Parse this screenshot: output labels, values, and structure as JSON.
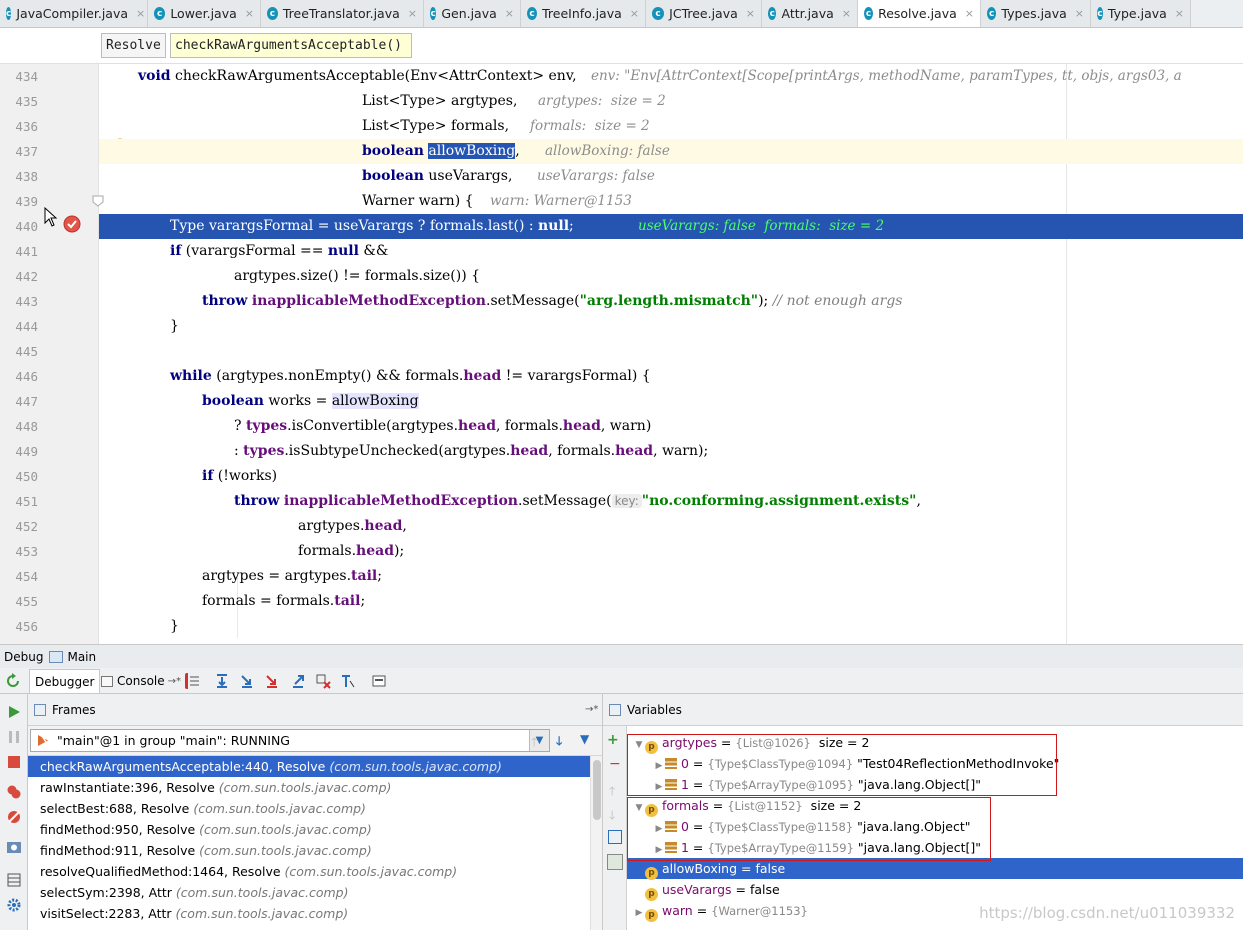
{
  "tabs": [
    {
      "label": "JavaCompiler.java",
      "active": false
    },
    {
      "label": "Lower.java",
      "active": false
    },
    {
      "label": "TreeTranslator.java",
      "active": false
    },
    {
      "label": "Gen.java",
      "active": false
    },
    {
      "label": "TreeInfo.java",
      "active": false
    },
    {
      "label": "JCTree.java",
      "active": false
    },
    {
      "label": "Attr.java",
      "active": false
    },
    {
      "label": "Resolve.java",
      "active": true
    },
    {
      "label": "Types.java",
      "active": false
    },
    {
      "label": "Type.java",
      "active": false
    }
  ],
  "breadcrumbs": [
    "Resolve",
    "checkRawArgumentsAcceptable()"
  ],
  "code": {
    "line_numbers": [
      "434",
      "435",
      "436",
      "437",
      "438",
      "439",
      "440",
      "441",
      "442",
      "443",
      "444",
      "445",
      "446",
      "447",
      "448",
      "449",
      "450",
      "451",
      "452",
      "453",
      "454",
      "455",
      "456"
    ],
    "l434": "void checkRawArgumentsAcceptable(Env<AttrContext> env,",
    "l434_kw": "void",
    "l434_rest": " checkRawArgumentsAcceptable(Env<AttrContext> env,",
    "l434_hint": "env: \"Env[AttrContext[Scope[printArgs, methodName, paramTypes, tt, objs, args03, a",
    "l435": "List<Type> argtypes,",
    "l435_hint": "argtypes:  size = 2",
    "l436": "List<Type> formals,",
    "l436_hint": "formals:  size = 2",
    "l437_kw": "boolean",
    "l437_sel": "allowBoxing",
    "l437_rest": ",",
    "l437_hint": "allowBoxing: false",
    "l438_kw": "boolean",
    "l438_rest": " useVarargs,",
    "l438_hint": "useVarargs: false",
    "l439": "Warner warn) {",
    "l439_hint": "warn: Warner@1153",
    "l440_a": "Type varargsFormal = useVarargs ? formals.last() : ",
    "l440_kw": "null",
    "l440_b": ";",
    "l440_hint": "useVarargs: false  formals:  size = 2",
    "l441_kw": "if",
    "l441_a": " (varargsFormal == ",
    "l441_kw2": "null",
    "l441_b": " &&",
    "l442": "argtypes.size() != formals.size()) {",
    "l443_kw": "throw",
    "l443_fn": "inapplicableMethodException",
    "l443_a": ".setMessage(",
    "l443_str": "\"arg.length.mismatch\"",
    "l443_b": "); ",
    "l443_cm": "// not enough args",
    "l444": "}",
    "l446_kw": "while",
    "l446_a": " (argtypes.nonEmpty() && formals.",
    "l446_f": "head",
    "l446_b": " != varargsFormal) {",
    "l447_kw": "boolean",
    "l447_a": " works = ",
    "l447_m": "allowBoxing",
    "l448_a": "? ",
    "l448_t": "types",
    "l448_b": ".isConvertible(argtypes.",
    "l448_h1": "head",
    "l448_c": ", formals.",
    "l448_h2": "head",
    "l448_d": ", warn)",
    "l449_a": ": ",
    "l449_t": "types",
    "l449_b": ".isSubtypeUnchecked(argtypes.",
    "l449_h1": "head",
    "l449_c": ", formals.",
    "l449_h2": "head",
    "l449_d": ", warn);",
    "l450_kw": "if",
    "l450_a": " (!works)",
    "l451_kw": "throw",
    "l451_fn": "inapplicableMethodException",
    "l451_a": ".setMessage(",
    "l451_param": "key:",
    "l451_str": "\"no.conforming.assignment.exists\"",
    "l451_b": ",",
    "l452_a": "argtypes.",
    "l452_h": "head",
    "l452_b": ",",
    "l453_a": "formals.",
    "l453_h": "head",
    "l453_b": ");",
    "l454_a": "argtypes = argtypes.",
    "l454_t": "tail",
    "l454_b": ";",
    "l455_a": "formals = formals.",
    "l455_t": "tail",
    "l455_b": ";",
    "l456": "}"
  },
  "debug": {
    "title": "Debug",
    "config": "Main",
    "tab_debugger": "Debugger",
    "tab_console": "Console",
    "console_arrow": "→*"
  },
  "frames": {
    "title": "Frames",
    "pin": "→*",
    "thread": "\"main\"@1 in group \"main\": RUNNING",
    "items": [
      {
        "method": "checkRawArgumentsAcceptable:440, Resolve",
        "pkg": "(com.sun.tools.javac.comp)"
      },
      {
        "method": "rawInstantiate:396, Resolve",
        "pkg": "(com.sun.tools.javac.comp)"
      },
      {
        "method": "selectBest:688, Resolve",
        "pkg": "(com.sun.tools.javac.comp)"
      },
      {
        "method": "findMethod:950, Resolve",
        "pkg": "(com.sun.tools.javac.comp)"
      },
      {
        "method": "findMethod:911, Resolve",
        "pkg": "(com.sun.tools.javac.comp)"
      },
      {
        "method": "resolveQualifiedMethod:1464, Resolve",
        "pkg": "(com.sun.tools.javac.comp)"
      },
      {
        "method": "selectSym:2398, Attr",
        "pkg": "(com.sun.tools.javac.comp)"
      },
      {
        "method": "visitSelect:2283, Attr",
        "pkg": "(com.sun.tools.javac.comp)"
      }
    ]
  },
  "variables": {
    "title": "Variables",
    "items": [
      {
        "name": "argtypes",
        "eq": " = ",
        "type": "{List@1026}",
        "value": "  size = 2"
      },
      {
        "name": "0",
        "eq": " = ",
        "type": "{Type$ClassType@1094}",
        "value": " \"Test04ReflectionMethodInvoke\""
      },
      {
        "name": "1",
        "eq": " = ",
        "type": "{Type$ArrayType@1095}",
        "value": " \"java.lang.Object[]\""
      },
      {
        "name": "formals",
        "eq": " = ",
        "type": "{List@1152}",
        "value": "  size = 2"
      },
      {
        "name": "0",
        "eq": " = ",
        "type": "{Type$ClassType@1158}",
        "value": " \"java.lang.Object\""
      },
      {
        "name": "1",
        "eq": " = ",
        "type": "{Type$ArrayType@1159}",
        "value": " \"java.lang.Object[]\""
      },
      {
        "name": "allowBoxing",
        "eq": " = ",
        "type": "",
        "value": "false"
      },
      {
        "name": "useVarargs",
        "eq": " = ",
        "type": "",
        "value": "false"
      },
      {
        "name": "warn",
        "eq": " = ",
        "type": "{Warner@1153}",
        "value": ""
      }
    ]
  },
  "watermark": "https://blog.csdn.net/u011039332",
  "colors": {
    "exec_line": "#2555b0",
    "selection": "#2f65ca",
    "redbox": "#d01818"
  }
}
